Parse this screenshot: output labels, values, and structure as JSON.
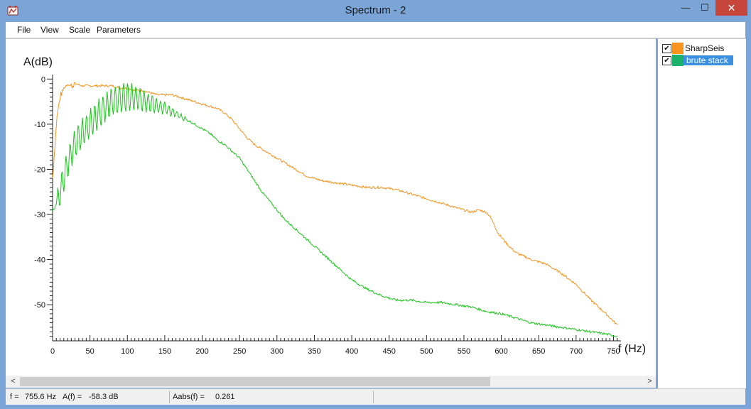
{
  "window": {
    "title": "Spectrum - 2",
    "close_glyph": "✕",
    "max_glyph": "☐",
    "min_glyph": "—"
  },
  "menu": [
    "File",
    "View",
    "Scale",
    "Parameters"
  ],
  "legend": [
    {
      "label": "SharpSeis",
      "color": "#f7931e",
      "checked": true,
      "selected": false
    },
    {
      "label": "brute stack",
      "color": "#1ab26b",
      "checked": true,
      "selected": true
    }
  ],
  "scroll": {
    "left_arrow": "<",
    "right_arrow": ">"
  },
  "status": {
    "f_label": "f =",
    "f_value": "755.6 Hz",
    "a_label": "A(f) =",
    "a_value": "-58.3 dB",
    "aabs_label": "Aabs(f) =",
    "aabs_value": "0.261"
  },
  "chart_data": {
    "type": "line",
    "ylabel": "A(dB)",
    "xlabel": "f (Hz)",
    "xlim": [
      0,
      760
    ],
    "ylim": [
      -58,
      1
    ],
    "xticks": [
      0,
      50,
      100,
      150,
      200,
      250,
      300,
      350,
      400,
      450,
      500,
      550,
      600,
      650,
      700,
      750
    ],
    "yticks": [
      0,
      -10,
      -20,
      -30,
      -40,
      -50
    ],
    "series": [
      {
        "name": "SharpSeis",
        "color": "#f7931e",
        "x": [
          0,
          3,
          6,
          10,
          15,
          20,
          25,
          30,
          40,
          50,
          60,
          70,
          80,
          90,
          100,
          110,
          120,
          130,
          140,
          150,
          160,
          170,
          180,
          190,
          200,
          210,
          220,
          230,
          240,
          250,
          260,
          270,
          280,
          290,
          300,
          310,
          320,
          330,
          340,
          350,
          360,
          380,
          400,
          420,
          440,
          460,
          480,
          500,
          520,
          540,
          560,
          570,
          580,
          585,
          590,
          595,
          600,
          610,
          620,
          640,
          660,
          680,
          700,
          720,
          740,
          755
        ],
        "y": [
          -22,
          -15,
          -8,
          -4,
          -2,
          -1,
          -1.5,
          -1,
          -1.5,
          -1.5,
          -1.5,
          -1.5,
          -1.5,
          -2,
          -2,
          -2.5,
          -2.5,
          -3,
          -3.5,
          -3.5,
          -3.5,
          -4,
          -4.5,
          -5,
          -5.5,
          -6,
          -6.5,
          -7.5,
          -9,
          -11,
          -13,
          -14.5,
          -15.5,
          -16.5,
          -17.5,
          -18.5,
          -19.5,
          -20.5,
          -21.5,
          -22,
          -22.5,
          -23,
          -23.5,
          -24,
          -24,
          -24.5,
          -25.5,
          -26.5,
          -27.5,
          -28.5,
          -29.5,
          -29,
          -29.5,
          -30.5,
          -32,
          -34,
          -35,
          -37,
          -38.5,
          -40,
          -41,
          -43,
          -45.5,
          -49,
          -52,
          -54.5
        ]
      },
      {
        "name": "brute stack",
        "color": "#1ab26b",
        "x": [
          0,
          3,
          6,
          10,
          15,
          20,
          25,
          30,
          40,
          50,
          60,
          70,
          80,
          90,
          100,
          110,
          120,
          130,
          140,
          150,
          160,
          170,
          180,
          190,
          200,
          210,
          220,
          230,
          240,
          250,
          260,
          270,
          280,
          290,
          300,
          310,
          320,
          330,
          340,
          350,
          360,
          380,
          400,
          420,
          440,
          460,
          480,
          500,
          520,
          540,
          560,
          580,
          600,
          620,
          640,
          660,
          680,
          700,
          720,
          740,
          755
        ],
        "y": [
          -29,
          -28.5,
          -27,
          -24,
          -21,
          -18,
          -15.5,
          -13.5,
          -11,
          -9,
          -7,
          -5.5,
          -4,
          -3.5,
          -3,
          -3.2,
          -4,
          -4.7,
          -5.5,
          -6,
          -7,
          -8,
          -9,
          -10,
          -11,
          -12,
          -13.5,
          -14.5,
          -16,
          -17.5,
          -20,
          -22.5,
          -25,
          -27,
          -29,
          -31,
          -32.5,
          -34,
          -35.5,
          -37,
          -38.5,
          -41.5,
          -44.5,
          -46.5,
          -48,
          -49,
          -49,
          -49.5,
          -49.5,
          -50,
          -50.5,
          -51.5,
          -52,
          -53,
          -54,
          -54.5,
          -55,
          -55.5,
          -56,
          -56.5,
          -57
        ]
      }
    ]
  }
}
